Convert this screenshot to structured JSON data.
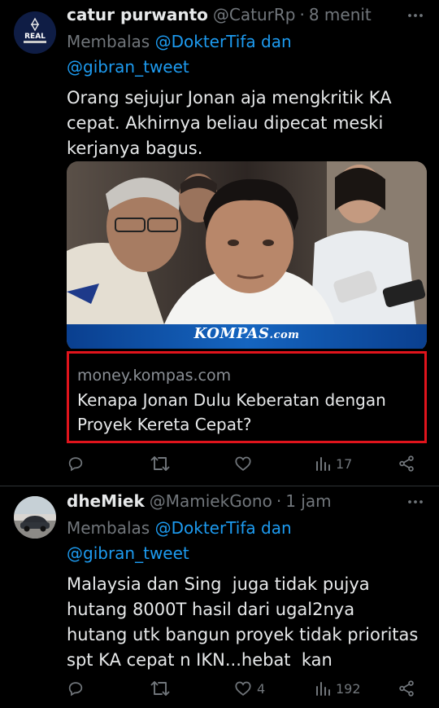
{
  "tweets": [
    {
      "author_name": "catur purwanto",
      "handle": "@CaturRp",
      "time": "8 menit",
      "avatar_text": "REAL",
      "reply_prefix": "Membalas",
      "reply_mention_1": "@DokterTifa dan",
      "reply_mention_2": "@gibran_tweet",
      "text": "Orang sejujur Jonan aja mengkritik KA cepat. Akhirnya beliau dipecat meski kerjanya bagus.",
      "card": {
        "photo_watermark": "KOMPAS",
        "photo_watermark_suffix": ".com",
        "domain": "money.kompas.com",
        "title": "Kenapa Jonan Dulu Keberatan dengan Proyek Kereta Cepat?"
      },
      "actions": {
        "replies": "",
        "retweets": "",
        "likes": "",
        "views": "17"
      }
    },
    {
      "author_name": "dheMiek",
      "handle": "@MamiekGono",
      "time": "1 jam",
      "reply_prefix": "Membalas",
      "reply_mention_1": "@DokterTifa dan",
      "reply_mention_2": "@gibran_tweet",
      "text": "Malaysia dan Sing  juga tidak pujya hutang 8000T hasil dari ugal2nya  hutang utk bangun proyek tidak prioritas spt KA cepat n IKN...hebat  kan",
      "actions": {
        "replies": "",
        "retweets": "",
        "likes": "4",
        "views": "192"
      }
    }
  ],
  "colors": {
    "background": "#000000",
    "text_primary": "#e7e9ea",
    "text_secondary": "#71767b",
    "link": "#1d9bf0",
    "highlight_border": "#e0141c",
    "kompas_blue": "#0b4ea2"
  }
}
